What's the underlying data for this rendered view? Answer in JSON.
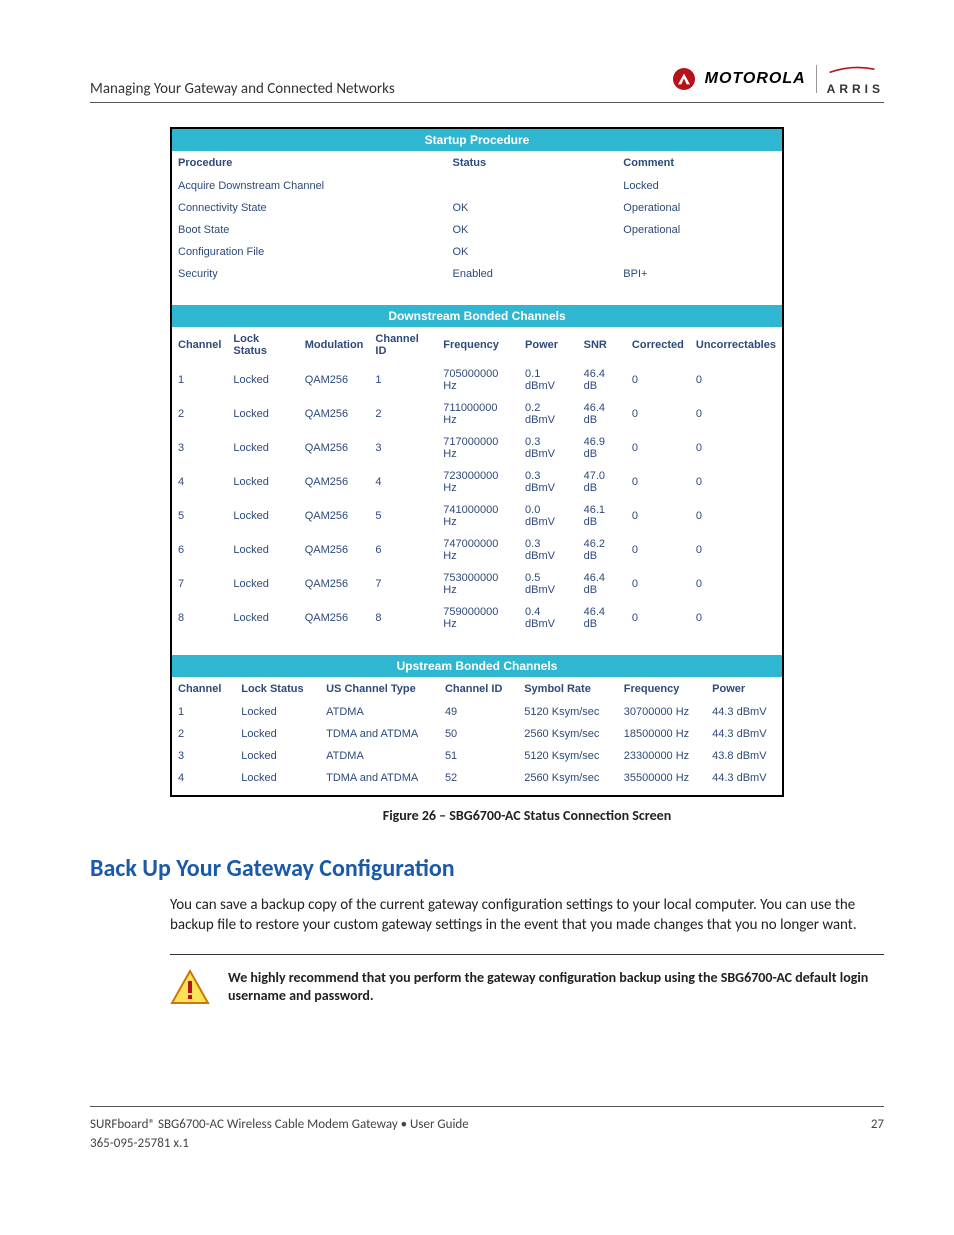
{
  "header": {
    "section_title": "Managing Your Gateway and Connected Networks",
    "brand_motorola": "MOTOROLA",
    "brand_arris": "ARRIS"
  },
  "startup": {
    "title": "Startup Procedure",
    "cols": [
      "Procedure",
      "Status",
      "Comment"
    ],
    "rows": [
      [
        "Acquire Downstream Channel",
        "",
        "Locked"
      ],
      [
        "Connectivity State",
        "OK",
        "Operational"
      ],
      [
        "Boot State",
        "OK",
        "Operational"
      ],
      [
        "Configuration File",
        "OK",
        ""
      ],
      [
        "Security",
        "Enabled",
        "BPI+"
      ]
    ]
  },
  "downstream": {
    "title": "Downstream Bonded Channels",
    "cols": [
      "Channel",
      "Lock Status",
      "Modulation",
      "Channel ID",
      "Frequency",
      "Power",
      "SNR",
      "Corrected",
      "Uncorrectables"
    ],
    "rows": [
      [
        "1",
        "Locked",
        "QAM256",
        "1",
        "705000000 Hz",
        "0.1 dBmV",
        "46.4 dB",
        "0",
        "0"
      ],
      [
        "2",
        "Locked",
        "QAM256",
        "2",
        "711000000 Hz",
        "0.2 dBmV",
        "46.4 dB",
        "0",
        "0"
      ],
      [
        "3",
        "Locked",
        "QAM256",
        "3",
        "717000000 Hz",
        "0.3 dBmV",
        "46.9 dB",
        "0",
        "0"
      ],
      [
        "4",
        "Locked",
        "QAM256",
        "4",
        "723000000 Hz",
        "0.3 dBmV",
        "47.0 dB",
        "0",
        "0"
      ],
      [
        "5",
        "Locked",
        "QAM256",
        "5",
        "741000000 Hz",
        "0.0 dBmV",
        "46.1 dB",
        "0",
        "0"
      ],
      [
        "6",
        "Locked",
        "QAM256",
        "6",
        "747000000 Hz",
        "0.3 dBmV",
        "46.2 dB",
        "0",
        "0"
      ],
      [
        "7",
        "Locked",
        "QAM256",
        "7",
        "753000000 Hz",
        "0.5 dBmV",
        "46.4 dB",
        "0",
        "0"
      ],
      [
        "8",
        "Locked",
        "QAM256",
        "8",
        "759000000 Hz",
        "0.4 dBmV",
        "46.4 dB",
        "0",
        "0"
      ]
    ]
  },
  "upstream": {
    "title": "Upstream Bonded Channels",
    "cols": [
      "Channel",
      "Lock Status",
      "US Channel Type",
      "Channel ID",
      "Symbol Rate",
      "Frequency",
      "Power"
    ],
    "rows": [
      [
        "1",
        "Locked",
        "ATDMA",
        "49",
        "5120 Ksym/sec",
        "30700000 Hz",
        "44.3 dBmV"
      ],
      [
        "2",
        "Locked",
        "TDMA and ATDMA",
        "50",
        "2560 Ksym/sec",
        "18500000 Hz",
        "44.3 dBmV"
      ],
      [
        "3",
        "Locked",
        "ATDMA",
        "51",
        "5120 Ksym/sec",
        "23300000 Hz",
        "43.8 dBmV"
      ],
      [
        "4",
        "Locked",
        "TDMA and ATDMA",
        "52",
        "2560 Ksym/sec",
        "35500000 Hz",
        "44.3 dBmV"
      ]
    ]
  },
  "figure_caption": "Figure 26 – SBG6700-AC Status Connection Screen",
  "heading": "Back Up Your Gateway Configuration",
  "paragraph": "You can save a backup copy of the current gateway configuration settings to your local computer. You can use the backup file to restore your custom gateway settings in the event that you made changes that you no longer want.",
  "note": "We highly recommend that you perform the gateway configuration backup using the SBG6700-AC default login username and password.",
  "footer": {
    "left": "SURFboard® SBG6700-AC Wireless Cable Modem Gateway • User Guide",
    "docnum": "365-095-25781 x.1",
    "page": "27"
  }
}
